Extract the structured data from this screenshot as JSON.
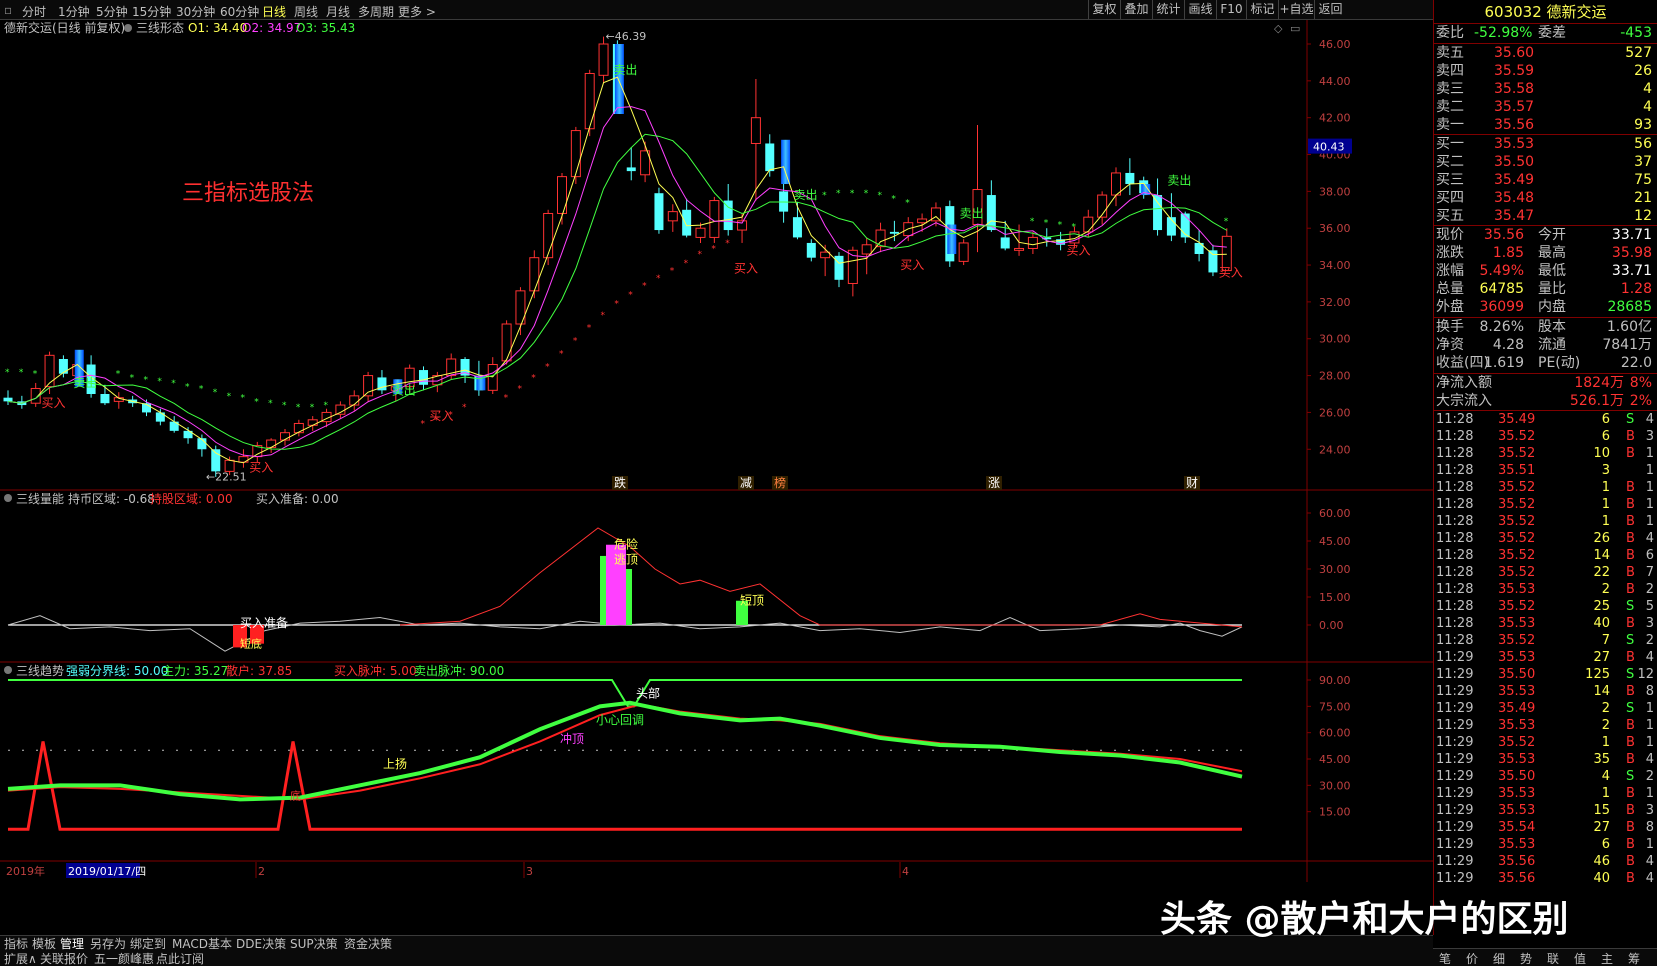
{
  "toolbar": {
    "periods": [
      "分时",
      "1分钟",
      "5分钟",
      "15分钟",
      "30分钟",
      "60分钟",
      "日线",
      "周线",
      "月线",
      "多周期",
      "更多 >"
    ],
    "active_period": "日线",
    "right_buttons": [
      "复权",
      "叠加",
      "统计",
      "画线",
      "F10",
      "标记",
      "+自选",
      "返回"
    ]
  },
  "main_panel": {
    "title": "德新交运(日线 前复权)",
    "indicator": "三线形态",
    "o1": "O1: 34.40",
    "o2": "O2: 34.97",
    "o3": "O3: 35.43",
    "annotation": "三指标选股法",
    "high_label": "46.39",
    "low_label": "22.51",
    "current_price_tag": "40.43",
    "y_ticks": [
      "46.00",
      "44.00",
      "42.00",
      "40.00",
      "38.00",
      "36.00",
      "34.00",
      "32.00",
      "30.00",
      "28.00",
      "26.00",
      "24.00"
    ],
    "buy_label": "买入",
    "sell_label": "卖出",
    "event_labels": [
      "跌",
      "减",
      "榜",
      "涨",
      "财"
    ]
  },
  "energy_panel": {
    "title": "三线量能",
    "hold_zone": "持币区域: -0.68",
    "share_zone": "持股区域: 0.00",
    "buy_prep": "买入准备: 0.00",
    "y_ticks": [
      "60.00",
      "45.00",
      "30.00",
      "15.00",
      "0.00"
    ],
    "label_danger": "危险",
    "label_escape": "逃顶",
    "label_short_top": "短顶",
    "label_buy_prep": "买入准备",
    "label_bottom": "短底"
  },
  "trend_panel": {
    "title": "三线趋势",
    "boundary": "强弱分界线: 50.00",
    "main_force": "主力: 35.27",
    "retail": "散户: 37.85",
    "buy_pulse": "买入脉冲: 5.00",
    "sell_pulse": "卖出脉冲: 90.00",
    "y_ticks": [
      "90.00",
      "75.00",
      "60.00",
      "45.00",
      "30.00",
      "15.00"
    ],
    "label_top": "头部",
    "label_pullback": "小心回调",
    "label_rush": "冲顶",
    "label_rise": "上扬",
    "label_bottom": "底"
  },
  "x_axis": {
    "year": "2019年",
    "date": "2019/01/17/四",
    "months": [
      "2",
      "3",
      "4"
    ]
  },
  "quote": {
    "code_name": "603032 德新交运",
    "wei_bi_label": "委比",
    "wei_bi": "-52.98%",
    "wei_cha_label": "委差",
    "wei_cha": "-453",
    "asks": [
      {
        "label": "卖五",
        "price": "35.60",
        "vol": "527"
      },
      {
        "label": "卖四",
        "price": "35.59",
        "vol": "26"
      },
      {
        "label": "卖三",
        "price": "35.58",
        "vol": "4"
      },
      {
        "label": "卖二",
        "price": "35.57",
        "vol": "4"
      },
      {
        "label": "卖一",
        "price": "35.56",
        "vol": "93"
      }
    ],
    "bids": [
      {
        "label": "买一",
        "price": "35.53",
        "vol": "56"
      },
      {
        "label": "买二",
        "price": "35.50",
        "vol": "37"
      },
      {
        "label": "买三",
        "price": "35.49",
        "vol": "75"
      },
      {
        "label": "买四",
        "price": "35.48",
        "vol": "21"
      },
      {
        "label": "买五",
        "price": "35.47",
        "vol": "12"
      }
    ],
    "stats": [
      {
        "l1": "现价",
        "v1": "35.56",
        "l2": "今开",
        "v2": "33.71"
      },
      {
        "l1": "涨跌",
        "v1": "1.85",
        "l2": "最高",
        "v2": "35.98"
      },
      {
        "l1": "涨幅",
        "v1": "5.49%",
        "l2": "最低",
        "v2": "33.71"
      },
      {
        "l1": "总量",
        "v1": "64785",
        "l2": "量比",
        "v2": "1.28"
      },
      {
        "l1": "外盘",
        "v1": "36099",
        "l2": "内盘",
        "v2": "28685"
      }
    ],
    "stats2": [
      {
        "l1": "换手",
        "v1": "8.26%",
        "l2": "股本",
        "v2": "1.60亿"
      },
      {
        "l1": "净资",
        "v1": "4.28",
        "l2": "流通",
        "v2": "7841万"
      },
      {
        "l1": "收益(四)",
        "v1": "1.619",
        "l2": "PE(动)",
        "v2": "22.0"
      }
    ],
    "flows": [
      {
        "label": "净流入额",
        "value": "1824万",
        "pct": "8%"
      },
      {
        "label": "大宗流入",
        "value": "526.1万",
        "pct": "2%"
      }
    ],
    "ticks": [
      {
        "t": "11:28",
        "p": "35.49",
        "v": "6",
        "s": "S",
        "n": "4"
      },
      {
        "t": "11:28",
        "p": "35.52",
        "v": "6",
        "s": "B",
        "n": "3"
      },
      {
        "t": "11:28",
        "p": "35.52",
        "v": "10",
        "s": "B",
        "n": "1"
      },
      {
        "t": "11:28",
        "p": "35.51",
        "v": "3",
        "s": "",
        "n": "1"
      },
      {
        "t": "11:28",
        "p": "35.52",
        "v": "1",
        "s": "B",
        "n": "1"
      },
      {
        "t": "11:28",
        "p": "35.52",
        "v": "1",
        "s": "B",
        "n": "1"
      },
      {
        "t": "11:28",
        "p": "35.52",
        "v": "1",
        "s": "B",
        "n": "1"
      },
      {
        "t": "11:28",
        "p": "35.52",
        "v": "26",
        "s": "B",
        "n": "4"
      },
      {
        "t": "11:28",
        "p": "35.52",
        "v": "14",
        "s": "B",
        "n": "6"
      },
      {
        "t": "11:28",
        "p": "35.52",
        "v": "22",
        "s": "B",
        "n": "7"
      },
      {
        "t": "11:28",
        "p": "35.53",
        "v": "2",
        "s": "B",
        "n": "2"
      },
      {
        "t": "11:28",
        "p": "35.52",
        "v": "25",
        "s": "S",
        "n": "5"
      },
      {
        "t": "11:28",
        "p": "35.53",
        "v": "40",
        "s": "B",
        "n": "3"
      },
      {
        "t": "11:28",
        "p": "35.52",
        "v": "7",
        "s": "S",
        "n": "2"
      },
      {
        "t": "11:29",
        "p": "35.53",
        "v": "27",
        "s": "B",
        "n": "4"
      },
      {
        "t": "11:29",
        "p": "35.50",
        "v": "125",
        "s": "S",
        "n": "12"
      },
      {
        "t": "11:29",
        "p": "35.53",
        "v": "14",
        "s": "B",
        "n": "8"
      },
      {
        "t": "11:29",
        "p": "35.49",
        "v": "2",
        "s": "S",
        "n": "1"
      },
      {
        "t": "11:29",
        "p": "35.53",
        "v": "2",
        "s": "B",
        "n": "1"
      },
      {
        "t": "11:29",
        "p": "35.52",
        "v": "1",
        "s": "B",
        "n": "1"
      },
      {
        "t": "11:29",
        "p": "35.53",
        "v": "35",
        "s": "B",
        "n": "4"
      },
      {
        "t": "11:29",
        "p": "35.50",
        "v": "4",
        "s": "S",
        "n": "2"
      },
      {
        "t": "11:29",
        "p": "35.53",
        "v": "1",
        "s": "B",
        "n": "1"
      },
      {
        "t": "11:29",
        "p": "35.53",
        "v": "15",
        "s": "B",
        "n": "3"
      },
      {
        "t": "11:29",
        "p": "35.54",
        "v": "27",
        "s": "B",
        "n": "8"
      },
      {
        "t": "11:29",
        "p": "35.53",
        "v": "6",
        "s": "B",
        "n": "1"
      },
      {
        "t": "11:29",
        "p": "35.56",
        "v": "46",
        "s": "B",
        "n": "4"
      },
      {
        "t": "11:29",
        "p": "35.56",
        "v": "40",
        "s": "B",
        "n": "4"
      }
    ],
    "bottom_tabs": [
      "笔",
      "价",
      "细",
      "势",
      "联",
      "值",
      "主",
      "筹"
    ]
  },
  "bottombar": {
    "tabs": [
      "指标",
      "模板",
      "管理",
      "另存为",
      "绑定到",
      "MACD基本",
      "DDE决策",
      "SUP决策",
      "资金决策"
    ],
    "active_tab": "管理",
    "tabs2": [
      "扩展∧",
      "关联报价",
      "五一颜峰惠",
      "点此订阅"
    ]
  },
  "watermark": "头条 @散户和大户的区别",
  "chart_data": {
    "type": "candlestick",
    "price_axis": [
      22,
      47
    ],
    "candles": [
      [
        26.8,
        27.2,
        26.4,
        26.6
      ],
      [
        26.6,
        26.9,
        26.2,
        26.4
      ],
      [
        26.5,
        27.6,
        26.3,
        27.3
      ],
      [
        27.4,
        29.3,
        27.0,
        29.1
      ],
      [
        28.9,
        29.1,
        27.9,
        28.1
      ],
      [
        28.0,
        28.8,
        27.7,
        28.6
      ],
      [
        28.6,
        29.1,
        26.8,
        27.0
      ],
      [
        27.0,
        27.5,
        26.4,
        26.5
      ],
      [
        26.6,
        27.1,
        26.2,
        26.8
      ],
      [
        26.7,
        26.9,
        26.3,
        26.5
      ],
      [
        26.5,
        26.7,
        25.8,
        26.0
      ],
      [
        26.0,
        26.2,
        25.3,
        25.5
      ],
      [
        25.5,
        25.8,
        24.9,
        25.0
      ],
      [
        25.0,
        25.2,
        24.3,
        24.6
      ],
      [
        24.6,
        24.8,
        23.6,
        24.0
      ],
      [
        24.0,
        24.2,
        22.5,
        22.8
      ],
      [
        22.8,
        23.6,
        22.6,
        23.4
      ],
      [
        23.3,
        24.0,
        23.0,
        23.6
      ],
      [
        23.6,
        24.4,
        23.3,
        24.2
      ],
      [
        24.1,
        24.6,
        23.8,
        24.5
      ],
      [
        24.5,
        25.1,
        24.2,
        24.9
      ],
      [
        24.9,
        25.6,
        24.7,
        25.4
      ],
      [
        25.3,
        25.8,
        25.0,
        25.6
      ],
      [
        25.5,
        26.2,
        25.2,
        26.0
      ],
      [
        25.9,
        26.6,
        25.7,
        26.4
      ],
      [
        26.4,
        27.2,
        26.1,
        26.9
      ],
      [
        26.9,
        28.2,
        26.6,
        28.0
      ],
      [
        27.9,
        28.3,
        27.0,
        27.2
      ],
      [
        27.2,
        27.8,
        26.6,
        27.4
      ],
      [
        27.4,
        28.6,
        27.1,
        28.4
      ],
      [
        28.3,
        28.5,
        27.2,
        27.5
      ],
      [
        27.5,
        28.2,
        27.1,
        28.0
      ],
      [
        28.0,
        29.2,
        27.8,
        28.9
      ],
      [
        28.9,
        29.0,
        27.6,
        28.0
      ],
      [
        28.0,
        28.8,
        26.9,
        27.2
      ],
      [
        27.2,
        29.0,
        27.0,
        28.6
      ],
      [
        28.8,
        31.0,
        28.6,
        30.8
      ],
      [
        30.8,
        32.8,
        30.2,
        32.6
      ],
      [
        32.6,
        34.8,
        32.2,
        34.4
      ],
      [
        34.4,
        37.0,
        34.0,
        36.8
      ],
      [
        36.8,
        39.0,
        36.2,
        38.8
      ],
      [
        38.8,
        41.5,
        38.4,
        41.3
      ],
      [
        41.4,
        44.6,
        41.0,
        44.4
      ],
      [
        44.3,
        46.4,
        43.9,
        46.0
      ],
      [
        46.0,
        46.2,
        42.2,
        42.2
      ],
      [
        39.3,
        40.4,
        38.6,
        39.1
      ],
      [
        38.9,
        40.7,
        38.5,
        40.2
      ],
      [
        37.9,
        38.2,
        35.7,
        35.9
      ],
      [
        36.4,
        37.3,
        35.8,
        36.9
      ],
      [
        37.0,
        37.6,
        35.5,
        35.6
      ],
      [
        35.5,
        36.3,
        35.2,
        36.0
      ],
      [
        35.5,
        37.7,
        35.2,
        37.5
      ],
      [
        37.5,
        38.4,
        35.6,
        35.9
      ],
      [
        35.9,
        36.8,
        35.2,
        36.4
      ],
      [
        40.6,
        44.1,
        37.5,
        42.0
      ],
      [
        40.6,
        41.1,
        38.8,
        39.1
      ],
      [
        38.0,
        38.7,
        36.3,
        36.9
      ],
      [
        36.6,
        37.4,
        35.4,
        35.5
      ],
      [
        35.2,
        35.4,
        34.2,
        34.4
      ],
      [
        34.4,
        35.1,
        33.4,
        34.7
      ],
      [
        34.5,
        34.7,
        32.8,
        33.2
      ],
      [
        33.0,
        35.0,
        32.3,
        34.8
      ],
      [
        34.6,
        35.5,
        33.5,
        35.1
      ],
      [
        35.0,
        36.3,
        34.7,
        35.9
      ],
      [
        35.8,
        36.4,
        35.3,
        35.7
      ],
      [
        35.6,
        36.6,
        35.3,
        36.3
      ],
      [
        36.3,
        36.8,
        35.8,
        36.5
      ],
      [
        36.4,
        37.4,
        36.1,
        37.1
      ],
      [
        37.2,
        37.5,
        33.9,
        34.2
      ],
      [
        34.2,
        35.4,
        34.0,
        35.2
      ],
      [
        36.2,
        41.6,
        34.7,
        38.1
      ],
      [
        37.8,
        38.6,
        35.8,
        35.9
      ],
      [
        35.5,
        36.4,
        34.8,
        34.9
      ],
      [
        34.8,
        36.2,
        34.5,
        34.9
      ],
      [
        34.9,
        35.8,
        34.6,
        35.5
      ],
      [
        35.5,
        36.0,
        35.0,
        35.4
      ],
      [
        35.4,
        35.8,
        34.8,
        35.1
      ],
      [
        35.2,
        36.1,
        34.9,
        35.8
      ],
      [
        35.8,
        37.0,
        35.5,
        36.6
      ],
      [
        36.6,
        38.0,
        36.2,
        37.8
      ],
      [
        37.8,
        39.3,
        37.2,
        39.0
      ],
      [
        39.0,
        39.8,
        37.8,
        38.4
      ],
      [
        38.6,
        38.8,
        37.6,
        37.9
      ],
      [
        37.8,
        38.7,
        35.6,
        35.9
      ],
      [
        36.6,
        37.9,
        35.3,
        35.6
      ],
      [
        36.8,
        36.9,
        35.2,
        35.5
      ],
      [
        35.2,
        35.9,
        34.2,
        34.6
      ],
      [
        34.8,
        35.1,
        33.4,
        33.6
      ],
      [
        33.7,
        36.0,
        33.7,
        35.56
      ]
    ]
  }
}
